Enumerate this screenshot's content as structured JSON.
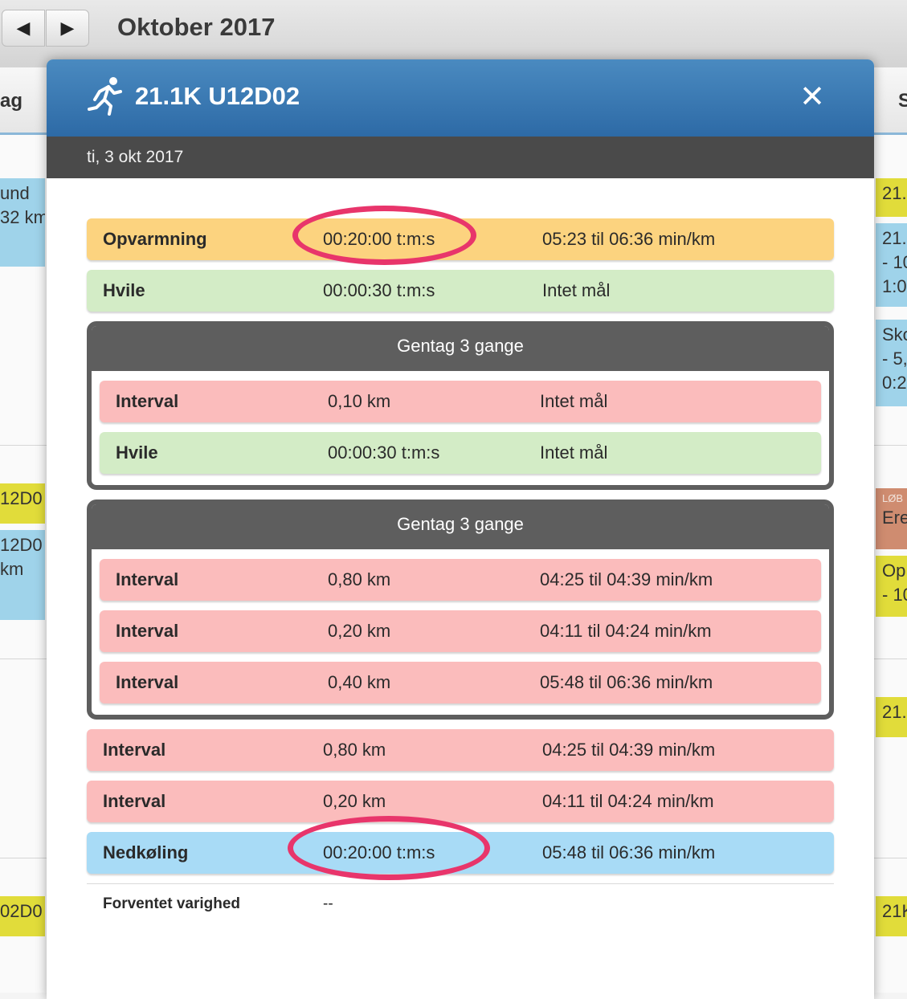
{
  "calendar": {
    "month_title": "Oktober 2017",
    "prev_icon": "triangle-left",
    "next_icon": "triangle-right",
    "left_header": "ag",
    "right_header": "S",
    "left_events": [
      "und",
      "32 km",
      "12D0",
      "12D0",
      "km",
      "02D0"
    ],
    "right_events": [
      "21.",
      "21.",
      "- 10",
      "1:0",
      "Sko",
      "- 5,",
      "0:2",
      "LØB",
      "Ere",
      "Op",
      "- 10",
      "21.",
      "21K"
    ]
  },
  "modal": {
    "icon": "runner-icon",
    "title": "21.1K U12D02",
    "close_label": "✕",
    "date": "ti, 3 okt 2017",
    "steps_before": [
      {
        "type": "Opvarmning",
        "target": "00:20:00 t:m:s",
        "goal": "05:23 til 06:36 min/km",
        "color": "orange"
      },
      {
        "type": "Hvile",
        "target": "00:00:30 t:m:s",
        "goal": "Intet mål",
        "color": "green"
      }
    ],
    "repeats": [
      {
        "label": "Gentag 3 gange",
        "steps": [
          {
            "type": "Interval",
            "target": "0,10 km",
            "goal": "Intet mål",
            "color": "red"
          },
          {
            "type": "Hvile",
            "target": "00:00:30 t:m:s",
            "goal": "Intet mål",
            "color": "green"
          }
        ]
      },
      {
        "label": "Gentag 3 gange",
        "steps": [
          {
            "type": "Interval",
            "target": "0,80 km",
            "goal": "04:25 til 04:39 min/km",
            "color": "red"
          },
          {
            "type": "Interval",
            "target": "0,20 km",
            "goal": "04:11 til 04:24 min/km",
            "color": "red"
          },
          {
            "type": "Interval",
            "target": "0,40 km",
            "goal": "05:48 til 06:36 min/km",
            "color": "red"
          }
        ]
      }
    ],
    "steps_after": [
      {
        "type": "Interval",
        "target": "0,80 km",
        "goal": "04:25 til 04:39 min/km",
        "color": "red"
      },
      {
        "type": "Interval",
        "target": "0,20 km",
        "goal": "04:11 til 04:24 min/km",
        "color": "red"
      },
      {
        "type": "Nedkøling",
        "target": "00:20:00 t:m:s",
        "goal": "05:48 til 06:36 min/km",
        "color": "lightblue"
      }
    ],
    "expected_duration_label": "Forventet varighed",
    "expected_duration_value": "--"
  },
  "colors": {
    "header_blue": "#2d6aa6",
    "warmup": "#fcd37f",
    "rest": "#d3ecc6",
    "interval": "#fbbcbc",
    "cooldown": "#a8dbf6",
    "highlight": "#e8356b"
  }
}
